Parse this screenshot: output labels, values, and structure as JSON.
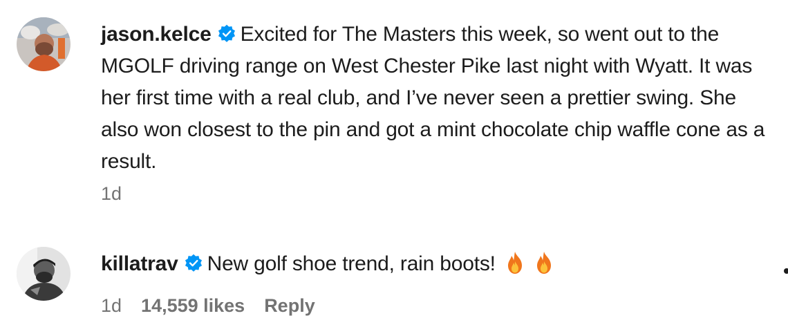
{
  "comments": [
    {
      "username": "jason.kelce",
      "verified": true,
      "text": "Excited for The Masters this week, so went out to the MGOLF driving range on West Chester Pike last night with Wyatt. It was her first time with a real club, and I’ve never seen a prettier swing. She also won closest to the pin and got a mint chocolate chip waffle cone as a result.",
      "time": "1d"
    },
    {
      "username": "killatrav",
      "verified": true,
      "text": "New golf shoe trend, rain boots!",
      "emojis": [
        "fire-icon",
        "fire-icon"
      ],
      "time": "1d",
      "likes": "14,559 likes",
      "reply": "Reply"
    }
  ],
  "colors": {
    "verified_badge": "#0095f6",
    "meta_text": "#737373",
    "primary_text": "#1c1c1c"
  }
}
